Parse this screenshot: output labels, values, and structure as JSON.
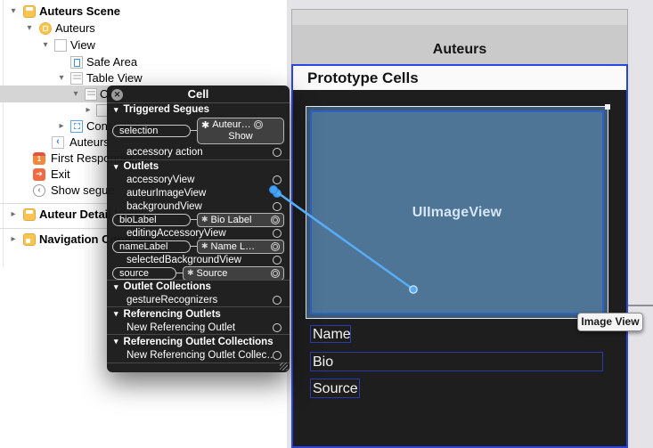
{
  "icons": {
    "disclosure_down": "▾",
    "disclosure_right": "▸",
    "close": "✕",
    "back_chevron": "‹",
    "segue_chevron": "‹",
    "exit_arrow": "➔",
    "first_responder_badge": "1",
    "ib_object": "✱"
  },
  "sidebar": {
    "items": [
      {
        "label": "Auteurs Scene"
      },
      {
        "label": "Auteurs"
      },
      {
        "label": "View"
      },
      {
        "label": "Safe Area"
      },
      {
        "label": "Table View"
      },
      {
        "label": "Cell"
      },
      {
        "label": ""
      },
      {
        "label": "Constraints"
      },
      {
        "label": "Auteurs"
      },
      {
        "label": "First Responder"
      },
      {
        "label": "Exit"
      },
      {
        "label": "Show segue"
      },
      {
        "label": "Auteur Detail View"
      },
      {
        "label": "Navigation Controller"
      }
    ]
  },
  "panel": {
    "title": "Cell",
    "sections": {
      "triggered_segues": "Triggered Segues",
      "outlets": "Outlets",
      "outlet_collections": "Outlet Collections",
      "referencing_outlets": "Referencing Outlets",
      "referencing_outlet_collections": "Referencing Outlet Collections"
    },
    "rows": {
      "selection": {
        "pill": "selection",
        "target_line1": "Auteur…",
        "target_line2": "Show"
      },
      "accessory_action": {
        "label": "accessory action"
      },
      "accessoryView": {
        "label": "accessoryView"
      },
      "auteurImageView": {
        "label": "auteurImageView"
      },
      "backgroundView": {
        "label": "backgroundView"
      },
      "bioLabel": {
        "pill": "bioLabel",
        "target": "Bio Label"
      },
      "editingAccessoryView": {
        "label": "editingAccessoryView"
      },
      "nameLabel": {
        "pill": "nameLabel",
        "target": "Name L…"
      },
      "selectedBackgroundView": {
        "label": "selectedBackgroundView"
      },
      "source": {
        "pill": "source",
        "target": "Source"
      },
      "gestureRecognizers": {
        "label": "gestureRecognizers"
      },
      "new_referencing_outlet": {
        "label": "New Referencing Outlet"
      },
      "new_referencing_outlet_collection": {
        "label": "New Referencing Outlet Collec…"
      }
    }
  },
  "canvas": {
    "nav_title": "Auteurs",
    "table_header": "Prototype Cells",
    "image_view_text": "UIImageView",
    "name_label": "Name",
    "bio_label": "Bio",
    "source_label": "Source",
    "tooltip": "Image View"
  },
  "colors": {
    "selection_blue": "#2b46e0",
    "label_outline_blue": "#2a3aae",
    "connection_blue": "#56adf5",
    "image_view_fill": "#4e7496",
    "scene_icon_yellow": "#f9c552",
    "panel_background": "#1a1a1a"
  }
}
